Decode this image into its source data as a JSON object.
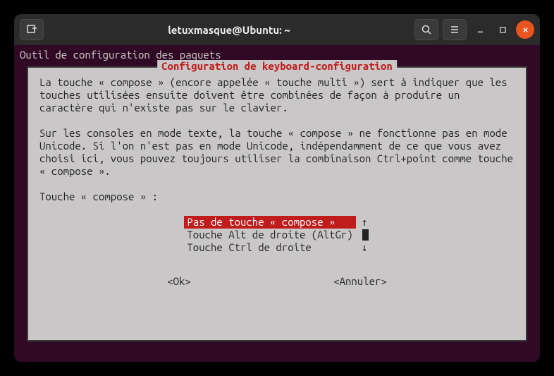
{
  "window": {
    "title": "letuxmasque@Ubuntu: ~"
  },
  "terminal": {
    "tool_header": "Outil de configuration des paquets"
  },
  "dialog": {
    "title": "Configuration de keyboard-configuration",
    "paragraph1": "La touche « compose » (encore appelée « touche multi ») sert à indiquer que les touches utilisées ensuite doivent être combinées de façon à produire un caractère qui n'existe pas sur le clavier.",
    "paragraph2": "Sur les consoles en mode texte, la touche « compose » ne fonctionne pas en mode Unicode. Si l'on n'est pas en mode Unicode, indépendamment de ce que vous avez choisi ici, vous pouvez toujours utiliser la combinaison Ctrl+point comme touche « compose ».",
    "prompt": "Touche « compose » :",
    "options": [
      "Pas de touche « compose »   ",
      "Touche Alt de droite (AltGr)",
      "Touche Ctrl de droite       "
    ],
    "selected_index": 0,
    "ok_label": "<Ok>",
    "cancel_label": "<Annuler>",
    "arrow_up": "↑",
    "arrow_down": "↓"
  }
}
